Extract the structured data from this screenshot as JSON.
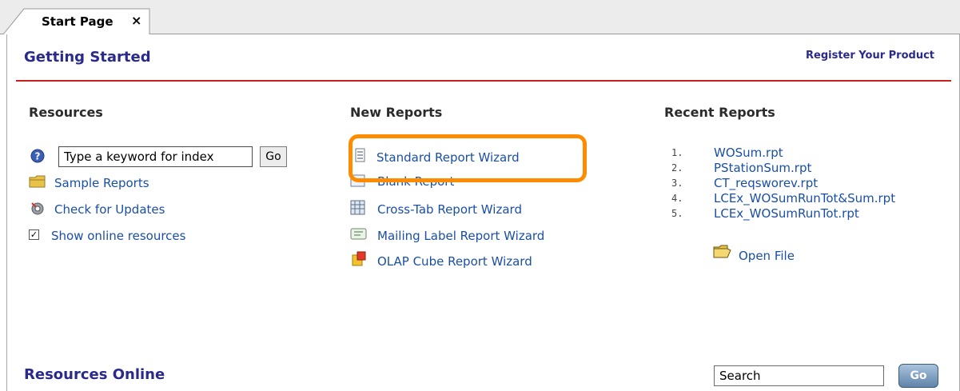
{
  "tabs": [
    {
      "label": "Start Page",
      "close_glyph": "×"
    }
  ],
  "header": {
    "title": "Getting Started",
    "register_link": "Register Your Product",
    "rule_color": "#c62020"
  },
  "resources": {
    "title": "Resources",
    "help_icon": "help-icon",
    "index_input": {
      "value": "Type a keyword for index"
    },
    "go_button": "Go",
    "sample_reports": "Sample Reports",
    "check_updates": "Check for Updates",
    "show_online": {
      "label": "Show online resources",
      "checked": true,
      "glyph": "✓"
    }
  },
  "new_reports": {
    "title": "New Reports",
    "items": [
      {
        "label": "Standard Report Wizard",
        "icon": "standard-report-icon"
      },
      {
        "label": "Blank Report",
        "icon": "blank-report-icon"
      },
      {
        "label": "Cross-Tab Report Wizard",
        "icon": "cross-tab-icon"
      },
      {
        "label": "Mailing Label Report Wizard",
        "icon": "mailing-label-icon"
      },
      {
        "label": "OLAP Cube Report Wizard",
        "icon": "olap-cube-icon"
      }
    ],
    "highlight_color": "#ff8c00"
  },
  "recent_reports": {
    "title": "Recent Reports",
    "items": [
      {
        "num": "1.",
        "label": "WOSum.rpt"
      },
      {
        "num": "2.",
        "label": "PStationSum.rpt"
      },
      {
        "num": "3.",
        "label": "CT_reqsworev.rpt"
      },
      {
        "num": "4.",
        "label": "LCEx_WOSumRunTot&Sum.rpt"
      },
      {
        "num": "5.",
        "label": "LCEx_WOSumRunTot.rpt"
      }
    ],
    "open_file": "Open File"
  },
  "resources_online": {
    "title": "Resources Online",
    "search": {
      "value": "Search"
    },
    "go_button": "Go"
  },
  "colors": {
    "link": "#1a4fa8",
    "heading": "#2a2a8c",
    "accent": "#ff8c00"
  }
}
